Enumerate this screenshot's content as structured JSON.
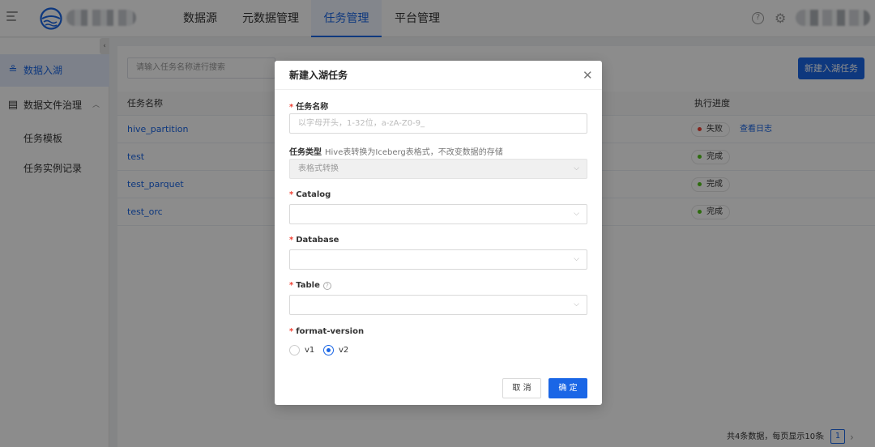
{
  "nav": {
    "tabs": [
      {
        "label": "数据源",
        "active": false
      },
      {
        "label": "元数据管理",
        "active": false
      },
      {
        "label": "任务管理",
        "active": true
      },
      {
        "label": "平台管理",
        "active": false
      }
    ],
    "icons": [
      "menu-icon",
      "logo-icon",
      "help-icon",
      "gear-icon"
    ],
    "help_glyph": "?",
    "gear_glyph": "⚙"
  },
  "sidebar": {
    "collapse_glyph": "‹",
    "items": [
      {
        "label": "数据入湖",
        "icon": "lake-icon",
        "glyph": "≗",
        "active": true
      },
      {
        "label": "数据文件治理",
        "icon": "file-governance-icon",
        "glyph": "▤",
        "expanded": true,
        "chevron": "︿"
      },
      {
        "label": "任务模板",
        "active": false
      },
      {
        "label": "任务实例记录",
        "active": false
      }
    ]
  },
  "main": {
    "search_placeholder": "请输入任务名称进行搜索",
    "create_button": "新建入湖任务",
    "columns": [
      "任务名称",
      "执行进度"
    ],
    "rows": [
      {
        "name": "hive_partition",
        "status": "失败",
        "status_color": "#f04134",
        "action": "查看日志"
      },
      {
        "name": "test",
        "status": "完成",
        "status_color": "#52c41a",
        "action": ""
      },
      {
        "name": "test_parquet",
        "status": "完成",
        "status_color": "#52c41a",
        "action": ""
      },
      {
        "name": "test_orc",
        "status": "完成",
        "status_color": "#52c41a",
        "action": ""
      }
    ],
    "pagination": {
      "summary": "共4条数据，每页显示10条",
      "prev": "‹",
      "current": "1",
      "next": "›"
    }
  },
  "modal": {
    "title": "新建入湖任务",
    "close_glyph": "✕",
    "required_mark": "*",
    "fields": {
      "task_name": {
        "label": "任务名称",
        "placeholder": "以字母开头，1-32位，a-zA-Z0-9_"
      },
      "task_type": {
        "label": "任务类型",
        "hint": "Hive表转换为Iceberg表格式，不改变数据的存储",
        "value": "表格式转换"
      },
      "catalog": {
        "label": "Catalog",
        "value": ""
      },
      "database": {
        "label": "Database",
        "value": ""
      },
      "table": {
        "label": "Table",
        "value": "",
        "help_glyph": "?"
      },
      "format_version": {
        "label": "format-version",
        "options": [
          "v1",
          "v2"
        ],
        "selected": "v2"
      }
    },
    "caret_glyph": "⌵",
    "cancel_label": "取 消",
    "ok_label": "确 定"
  },
  "colors": {
    "accent": "#1a66e6",
    "required": "#f04134",
    "success": "#52c41a",
    "mask": "rgba(0,0,0,0.45)"
  }
}
